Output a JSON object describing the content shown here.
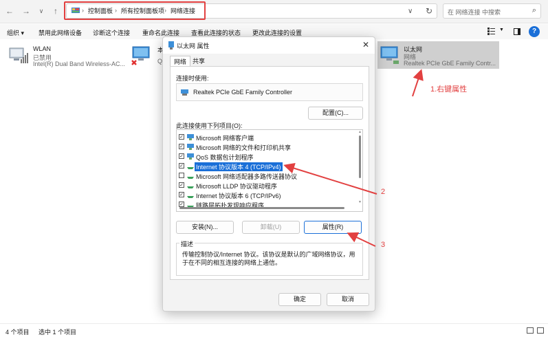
{
  "address_bar": {
    "breadcrumbs": [
      "控制面板",
      "所有控制面板项",
      "网络连接"
    ],
    "search_placeholder": "在 网络连接 中搜索"
  },
  "command_bar": {
    "items": [
      "组织 ▾",
      "禁用此网络设备",
      "诊断这个连接",
      "重命名此连接",
      "查看此连接的状态",
      "更改此连接的设置"
    ]
  },
  "adapters": [
    {
      "name": "WLAN",
      "status": "已禁用",
      "device": "Intel(R) Dual Band Wireless-AC..."
    },
    {
      "name": "本",
      "status": "Q",
      "device": ""
    },
    {
      "name": "以太网",
      "status": "网络",
      "device": "Realtek PCIe GbE Family Contr..."
    }
  ],
  "dialog": {
    "title": "以太网 属性",
    "tabs": [
      "网络",
      "共享"
    ],
    "connect_using_label": "连接时使用:",
    "adapter_name": "Realtek PCIe GbE Family Controller",
    "configure_button": "配置(C)...",
    "items_label": "此连接使用下列项目(O):",
    "items": [
      {
        "label": "Microsoft 网络客户端",
        "checked": true
      },
      {
        "label": "Microsoft 网络的文件和打印机共享",
        "checked": true
      },
      {
        "label": "QoS 数据包计划程序",
        "checked": true
      },
      {
        "label": "Internet 协议版本 4 (TCP/IPv4)",
        "checked": true,
        "selected": true
      },
      {
        "label": "Microsoft 网络适配器多路传送器协议",
        "checked": false
      },
      {
        "label": "Microsoft LLDP 协议驱动程序",
        "checked": true
      },
      {
        "label": "Internet 协议版本 6 (TCP/IPv6)",
        "checked": true
      },
      {
        "label": "链路层拓扑发现响应程序",
        "checked": true
      }
    ],
    "install_button": "安装(N)...",
    "uninstall_button": "卸载(U)",
    "properties_button": "属性(R)",
    "description_legend": "描述",
    "description_text": "传输控制协议/Internet 协议。该协议是默认的广域网络协议，用于在不同的相互连接的网络上通信。",
    "ok_button": "确定",
    "cancel_button": "取消"
  },
  "annotations": {
    "step1": "1.右键属性",
    "step2": "2",
    "step3": "3",
    "color": "#e24040"
  },
  "status_bar": {
    "item_count": "4 个项目",
    "selected": "选中 1 个项目"
  },
  "colors": {
    "accent": "#1a6fd8",
    "highlight_red": "#e24040"
  }
}
